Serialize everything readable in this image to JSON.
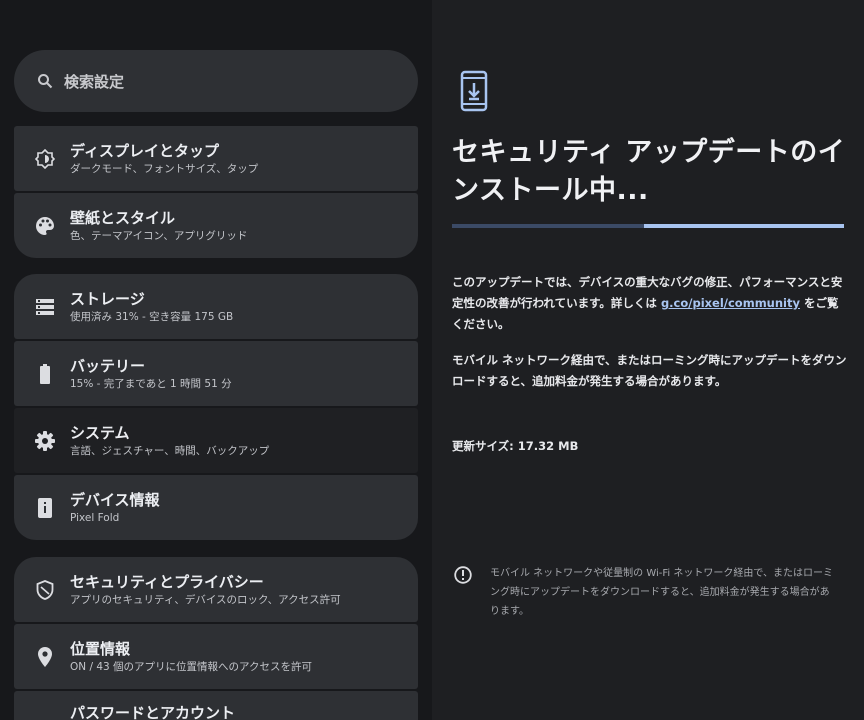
{
  "search": {
    "placeholder": "検索設定",
    "icon": "search-icon"
  },
  "groups": [
    {
      "items": [
        {
          "title": "ディスプレイとタップ",
          "subtitle": "ダークモード、フォントサイズ、タップ",
          "icon": "display-icon"
        },
        {
          "title": "壁紙とスタイル",
          "subtitle": "色、テーマアイコン、アプリグリッド",
          "icon": "palette-icon"
        }
      ]
    },
    {
      "items": [
        {
          "title": "ストレージ",
          "subtitle": "使用済み 31% - 空き容量 175 GB",
          "icon": "storage-icon"
        },
        {
          "title": "バッテリー",
          "subtitle": "15% - 完了まであと 1 時間 51 分",
          "icon": "battery-icon"
        },
        {
          "title": "システム",
          "subtitle": "言語、ジェスチャー、時間、バックアップ",
          "icon": "gear-icon"
        },
        {
          "title": "デバイス情報",
          "subtitle": "Pixel Fold",
          "icon": "device-info-icon"
        }
      ]
    },
    {
      "items": [
        {
          "title": "セキュリティとプライバシー",
          "subtitle": "アプリのセキュリティ、デバイスのロック、アクセス許可",
          "icon": "shield-icon"
        },
        {
          "title": "位置情報",
          "subtitle": "ON / 43 個のアプリに位置情報へのアクセスを許可",
          "icon": "location-pin-icon"
        },
        {
          "title": "パスワードとアカウント",
          "subtitle": "",
          "icon": "key-icon"
        }
      ]
    }
  ],
  "update": {
    "icon": "phone-download-icon",
    "title": "セキュリティ アップデートのインストール中...",
    "progress_fraction": 0.51,
    "description_before_link": "このアップデートでは、デバイスの重大なバグの修正、パフォーマンスと安定性の改善が行われています。詳しくは ",
    "link_text": "g.co/pixel/community",
    "description_after_link": " をご覧ください。",
    "mobile_warning": "モバイル ネットワーク経由で、またはローミング時にアップデートをダウンロードすると、追加料金が発生する場合があります。",
    "size_label": "更新サイズ: 17.32 MB",
    "note": "モバイル ネットワークや従量制の Wi-Fi ネットワーク経由で、またはローミング時にアップデートをダウンロードすると、追加料金が発生する場合があります。",
    "note_icon": "info-icon"
  },
  "colors": {
    "accent": "#a8c4f0",
    "card": "#2e3034",
    "background": "#17181b"
  }
}
